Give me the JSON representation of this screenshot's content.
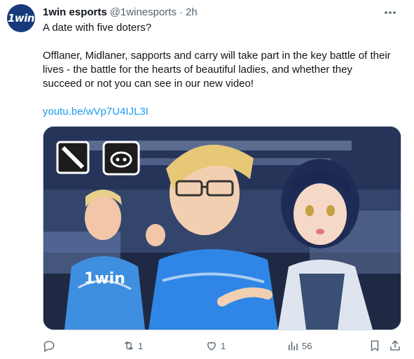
{
  "author": {
    "avatar_text": "1win",
    "display_name": "1win esports",
    "handle": "@1winesports",
    "separator": "·",
    "time": "2h"
  },
  "tweet": {
    "line1": "A date with five doters?",
    "body": "Offlaner, Midlaner, sapports and carry will take part in the key battle of their lives - the battle for the hearts of beautiful ladies, and whether they succeed or not you can see in our new video!",
    "link": "youtu.be/wVp7U4IJL3I"
  },
  "media": {
    "jersey_text": "1win"
  },
  "actions": {
    "replies": "",
    "retweets": "1",
    "likes": "1",
    "views": "56"
  },
  "colors": {
    "accent": "#1d9bf0",
    "muted": "#536471"
  }
}
